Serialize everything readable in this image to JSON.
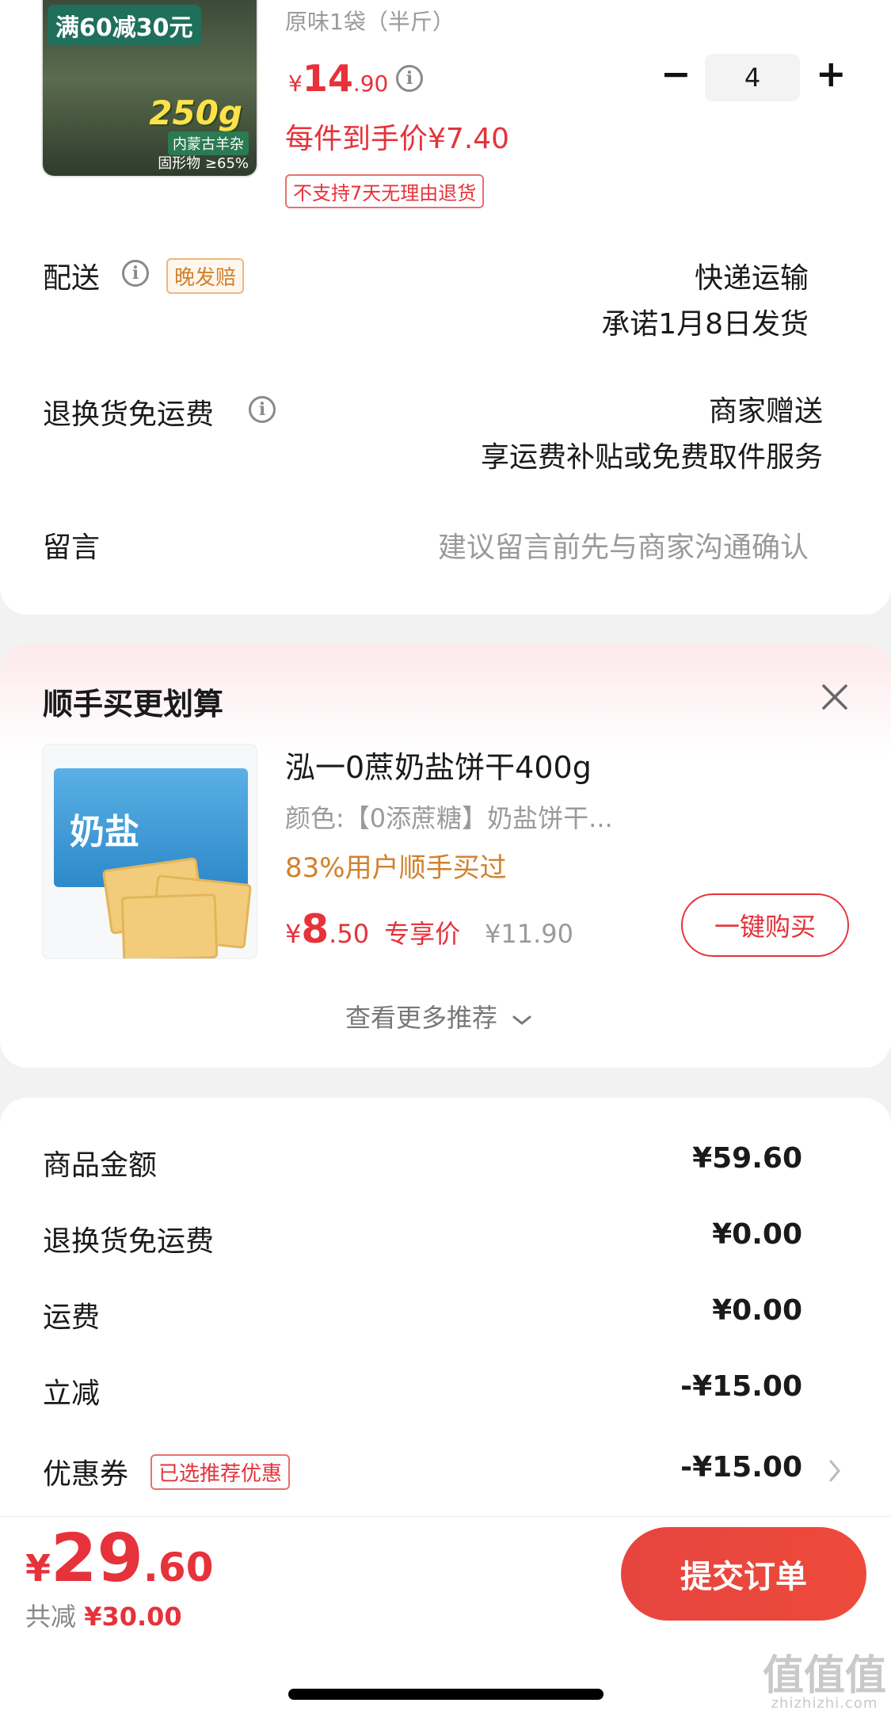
{
  "product": {
    "image_promo": "满60减30元",
    "image_weight": "250g",
    "image_sub": "内蒙古羊杂",
    "image_sub2": "固形物 ≥65%",
    "variant": "原味1袋（半斤）",
    "price_symbol": "¥",
    "price_int": "14",
    "price_dec": ".90",
    "unit_price": "每件到手价¥7.40",
    "return_tag": "不支持7天无理由退货",
    "qty_minus": "−",
    "qty": "4",
    "qty_plus": "+"
  },
  "delivery": {
    "label": "配送",
    "tag": "晚发赔",
    "method": "快递运输",
    "promise": "承诺1月8日发货"
  },
  "return_shipping": {
    "label": "退换货免运费",
    "line1": "商家赠送",
    "line2": "享运费补贴或免费取件服务"
  },
  "message": {
    "label": "留言",
    "placeholder": "建议留言前先与商家沟通确认"
  },
  "recommend": {
    "title": "顺手买更划算",
    "close_icon": "close-icon",
    "item_title": "泓一0蔗奶盐饼干400g",
    "item_spec": "颜色:【0添蔗糖】奶盐饼干...",
    "item_social": "83%用户顺手买过",
    "item_price_symbol": "¥",
    "item_price_int": "8",
    "item_price_dec": ".50",
    "item_price_label": "专享价",
    "item_orig_price": "¥11.90",
    "buy_label": "一键购买",
    "image_text": "奶盐",
    "more_label": "查看更多推荐"
  },
  "summary": {
    "rows": [
      {
        "label": "商品金额",
        "value": "¥59.60"
      },
      {
        "label": "退换货免运费",
        "value": "¥0.00"
      },
      {
        "label": "运费",
        "value": "¥0.00"
      },
      {
        "label": "立减",
        "value": "-¥15.00"
      },
      {
        "label": "优惠券",
        "tag": "已选推荐优惠",
        "value": "-¥15.00"
      }
    ]
  },
  "footer": {
    "total_symbol": "¥",
    "total_int": "29",
    "total_dec": ".60",
    "saved_label": "共减",
    "saved_value": "¥30.00",
    "submit_label": "提交订单"
  },
  "watermark": {
    "text": "值值值",
    "url": "zhizhizhi.com"
  },
  "colors": {
    "accent_red": "#e6323a",
    "orange": "#d2802c",
    "background": "#f2f2f2"
  }
}
